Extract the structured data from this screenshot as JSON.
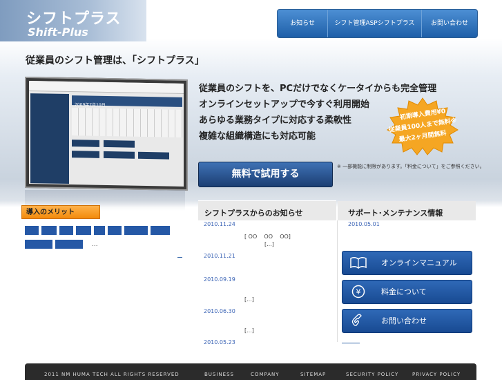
{
  "header": {
    "logo_jp": "シフトプラス",
    "logo_en": "Shift-Plus",
    "nav": [
      "お知らせ",
      "シフト管理ASPシフトプラス",
      "お問い合わせ"
    ]
  },
  "hero": {
    "tagline": "従業員のシフト管理は、「シフトプラス」",
    "features": [
      "従業員のシフトを、PCだけでなくケータイからも完全管理",
      "オンラインセットアップで今すぐ利用開始",
      "あらゆる業務タイプに対応する柔軟性",
      "複雑な組織構造にも対応可能"
    ],
    "badge": {
      "line1": "初期導入費用¥0",
      "line2": "従業員100人まで無料",
      "mark": "※",
      "line3": "最大2ヶ月間無料"
    },
    "trial_button": "無料で試用する",
    "note": "※ 一部機能に制限があります。「料金について」をご参照ください。",
    "screenshot_date": "2009年7月10日"
  },
  "merit": {
    "label": "導入のメリット",
    "ellipsis": "..."
  },
  "news": {
    "title": "シフトプラスからのお知らせ",
    "items": [
      {
        "date": "2010.11.24",
        "text": "[ OO    OO    OO]",
        "more": "[...]"
      },
      {
        "date": "2010.11.21",
        "text": "",
        "more": ""
      },
      {
        "date": "2010.09.19",
        "text": "",
        "more": "[...]"
      },
      {
        "date": "2010.06.30",
        "text": "",
        "more": "[...]"
      },
      {
        "date": "2010.05.23",
        "text": "",
        "more": ""
      }
    ]
  },
  "support": {
    "title": "サポート･メンテナンス情報",
    "date": "2010.05.01",
    "buttons": [
      {
        "label": "オンラインマニュアル",
        "icon": "book-icon"
      },
      {
        "label": "料金について",
        "icon": "yen-icon"
      },
      {
        "label": "お問い合わせ",
        "icon": "phone-icon"
      }
    ]
  },
  "footer": {
    "copyright": "2011 NM HUMA TECH ALL RIGHTS RESERVED",
    "links": [
      "BUSINESS",
      "COMPANY",
      "SITEMAP",
      "SECURITY POLICY",
      "PRIVACY POLICY"
    ]
  },
  "colors": {
    "accent": "#1e5fa8",
    "orange": "#f28b0c",
    "badge": "#f5a623",
    "footer": "#2b2b2b"
  }
}
